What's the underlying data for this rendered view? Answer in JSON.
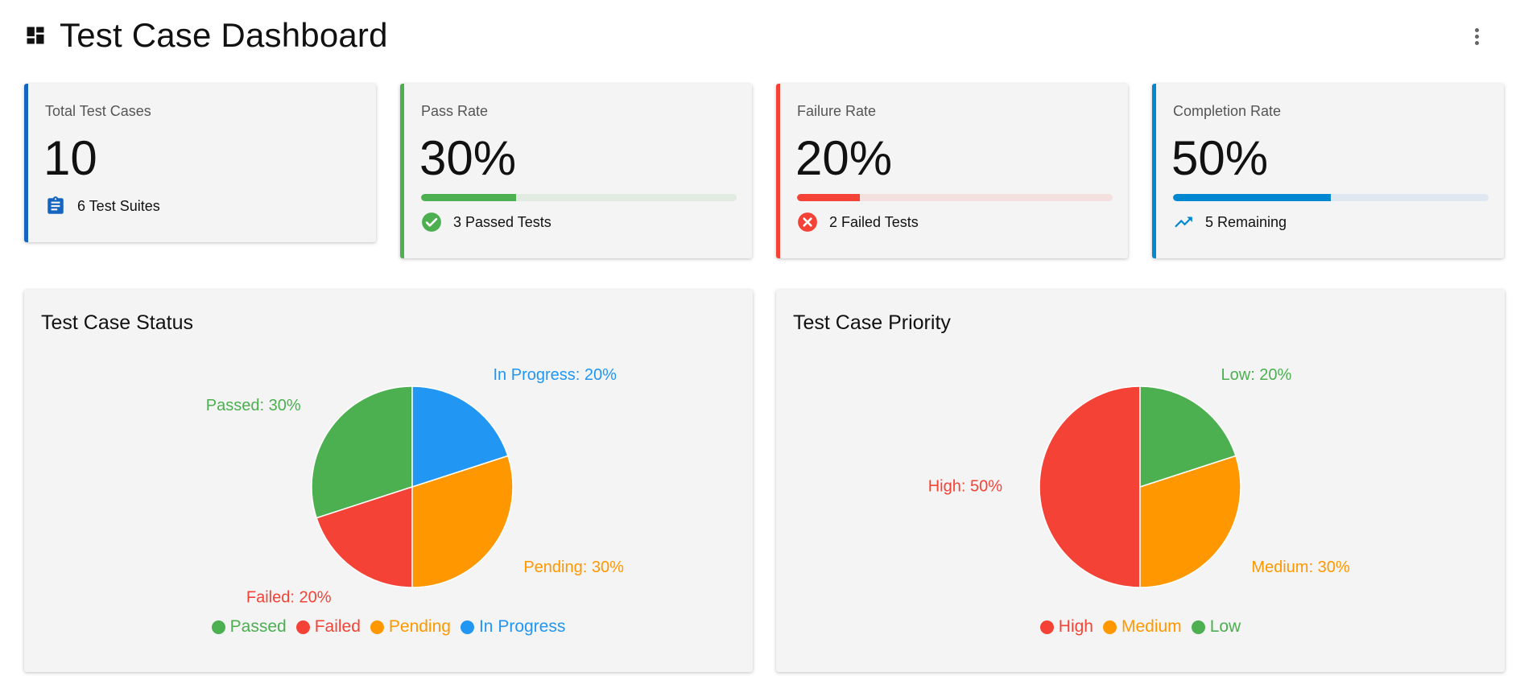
{
  "header": {
    "title": "Test Case Dashboard"
  },
  "colors": {
    "blue": "#1565c0",
    "green": "#4caf50",
    "red": "#f44336",
    "orange": "#ff9800",
    "lightblue": "#2196f3",
    "completion": "#0288d1"
  },
  "stats": {
    "total": {
      "label": "Total Test Cases",
      "value": "10",
      "footer": "6 Test Suites",
      "accent": "#1565c0",
      "icon": "clipboard-icon"
    },
    "pass": {
      "label": "Pass Rate",
      "value": "30%",
      "progress": 0.3,
      "footer": "3 Passed Tests",
      "accent": "#4caf50",
      "track": "#e2ebe2",
      "icon": "check-circle-icon"
    },
    "failure": {
      "label": "Failure Rate",
      "value": "20%",
      "progress": 0.2,
      "footer": "2 Failed Tests",
      "accent": "#f44336",
      "track": "#f4e0df",
      "icon": "cancel-circle-icon"
    },
    "completion": {
      "label": "Completion Rate",
      "value": "50%",
      "progress": 0.5,
      "footer": "5 Remaining",
      "accent": "#0288d1",
      "track": "#dfe8f1",
      "icon": "trending-up-icon"
    }
  },
  "chart_data": [
    {
      "type": "pie",
      "title": "Test Case Status",
      "categories": [
        "Passed",
        "Failed",
        "Pending",
        "In Progress"
      ],
      "values": [
        30,
        20,
        30,
        20
      ],
      "data_labels": [
        "Passed: 30%",
        "Failed: 20%",
        "Pending: 30%",
        "In Progress: 20%"
      ],
      "colors": [
        "#4caf50",
        "#f44336",
        "#ff9800",
        "#2196f3"
      ],
      "legend": "bottom"
    },
    {
      "type": "pie",
      "title": "Test Case Priority",
      "categories": [
        "High",
        "Medium",
        "Low"
      ],
      "values": [
        50,
        30,
        20
      ],
      "data_labels": [
        "High: 50%",
        "Medium: 30%",
        "Low: 20%"
      ],
      "colors": [
        "#f44336",
        "#ff9800",
        "#4caf50"
      ],
      "legend": "bottom"
    }
  ]
}
